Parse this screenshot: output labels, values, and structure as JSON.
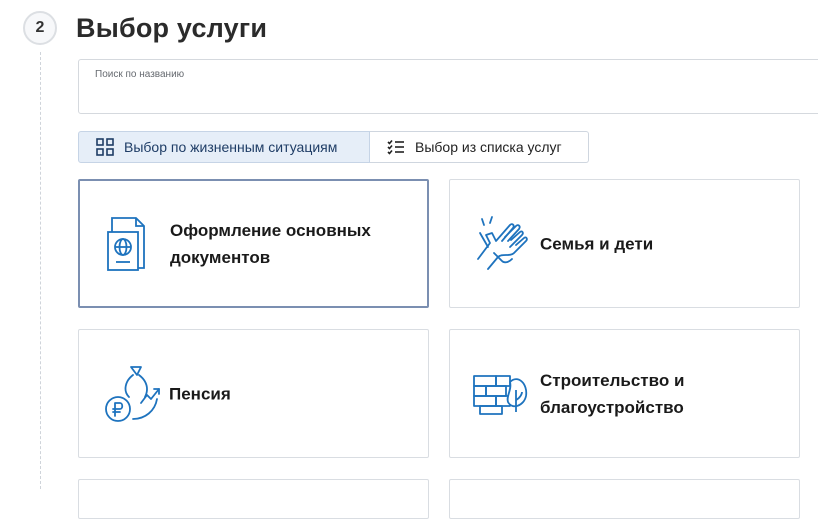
{
  "step": {
    "number": "2",
    "title": "Выбор услуги"
  },
  "search": {
    "label": "Поиск по названию"
  },
  "tabs": [
    {
      "label": "Выбор по жизненным ситуациям",
      "icon": "grid-icon",
      "active": true
    },
    {
      "label": "Выбор из списка услуг",
      "icon": "checklist-icon",
      "active": false
    }
  ],
  "cards": [
    {
      "title": "Оформление основных документов",
      "icon": "passport-icon",
      "selected": true
    },
    {
      "title": "Семья и дети",
      "icon": "hands-icon",
      "selected": false
    },
    {
      "title": "Пенсия",
      "icon": "ruble-bag-icon",
      "selected": false
    },
    {
      "title": "Строительство и благоустройство",
      "icon": "brick-wall-icon",
      "selected": false
    }
  ],
  "colors": {
    "accent": "#1e73be",
    "selected_border": "#7b8fb1",
    "active_tab_bg": "#e6eef8"
  }
}
